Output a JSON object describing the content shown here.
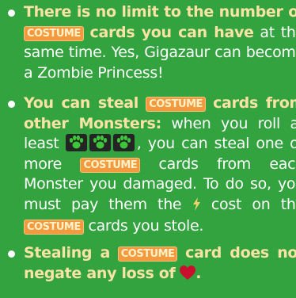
{
  "badge_label": "COSTUME",
  "colors": {
    "background": "#32a33e",
    "highlight": "#fbe3a6",
    "badge": "#f39a3f",
    "heart": "#c8102e",
    "bolt": "#f5d36a",
    "claw_bg": "#242424",
    "claw": "#3ec63a"
  },
  "bullet1": {
    "lead1": "There is no limit to the number of",
    "lead2": "cards you can have",
    "rest": " at the same time. Yes, Gigazaur can become a Zombie Princess!"
  },
  "bullet2": {
    "lead1": "You can steal",
    "lead2": "cards from other Monsters:",
    "text1": " when you roll at least",
    "text2": ", you can steal one or more",
    "text3": " cards from each Monster you damaged. To do so, you must pay them the",
    "text4": " cost on the",
    "text5": " cards you stole."
  },
  "bullet3": {
    "lead1": "Stealing a",
    "lead2": "card does not negate any loss of",
    "end": "."
  },
  "icons": {
    "claw": "claw-icon",
    "energy": "lightning-bolt-icon",
    "heart": "heart-icon"
  }
}
